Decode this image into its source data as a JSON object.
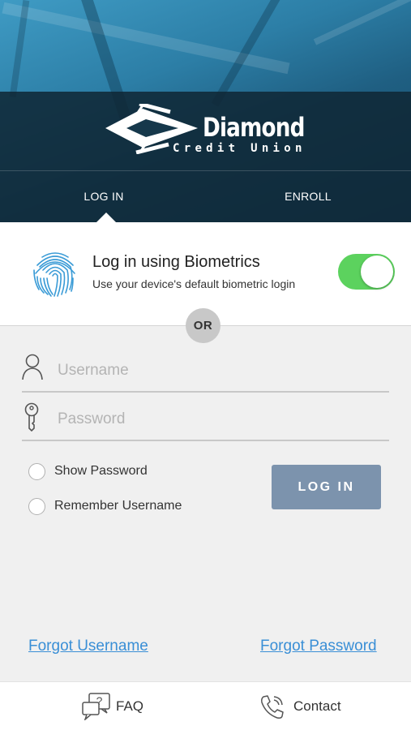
{
  "brand": {
    "name": "Diamond",
    "tagline": "Credit Union"
  },
  "tabs": [
    {
      "label": "LOG IN",
      "active": true
    },
    {
      "label": "ENROLL",
      "active": false
    }
  ],
  "biometrics": {
    "title": "Log in using Biometrics",
    "subtitle": "Use your device's default biometric login",
    "enabled": true,
    "icon": "fingerprint-icon"
  },
  "divider_label": "OR",
  "form": {
    "username_placeholder": "Username",
    "password_placeholder": "Password",
    "show_password_label": "Show Password",
    "remember_username_label": "Remember Username",
    "submit_label": "LOG IN"
  },
  "links": {
    "forgot_username": "Forgot Username",
    "forgot_password": "Forgot Password"
  },
  "footer": {
    "faq_label": "FAQ",
    "contact_label": "Contact"
  },
  "colors": {
    "toggle_on": "#5cd25e",
    "login_button": "#7c93ad",
    "link": "#3a8fd6"
  }
}
